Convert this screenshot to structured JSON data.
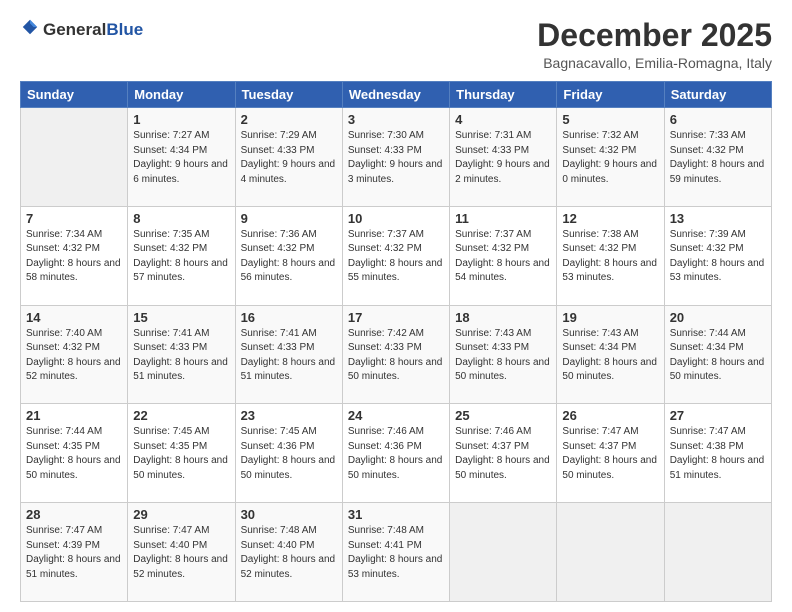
{
  "header": {
    "logo_general": "General",
    "logo_blue": "Blue",
    "month_title": "December 2025",
    "location": "Bagnacavallo, Emilia-Romagna, Italy"
  },
  "weekdays": [
    "Sunday",
    "Monday",
    "Tuesday",
    "Wednesday",
    "Thursday",
    "Friday",
    "Saturday"
  ],
  "weeks": [
    [
      {
        "day": "",
        "sunrise": "",
        "sunset": "",
        "daylight": ""
      },
      {
        "day": "1",
        "sunrise": "Sunrise: 7:27 AM",
        "sunset": "Sunset: 4:34 PM",
        "daylight": "Daylight: 9 hours and 6 minutes."
      },
      {
        "day": "2",
        "sunrise": "Sunrise: 7:29 AM",
        "sunset": "Sunset: 4:33 PM",
        "daylight": "Daylight: 9 hours and 4 minutes."
      },
      {
        "day": "3",
        "sunrise": "Sunrise: 7:30 AM",
        "sunset": "Sunset: 4:33 PM",
        "daylight": "Daylight: 9 hours and 3 minutes."
      },
      {
        "day": "4",
        "sunrise": "Sunrise: 7:31 AM",
        "sunset": "Sunset: 4:33 PM",
        "daylight": "Daylight: 9 hours and 2 minutes."
      },
      {
        "day": "5",
        "sunrise": "Sunrise: 7:32 AM",
        "sunset": "Sunset: 4:32 PM",
        "daylight": "Daylight: 9 hours and 0 minutes."
      },
      {
        "day": "6",
        "sunrise": "Sunrise: 7:33 AM",
        "sunset": "Sunset: 4:32 PM",
        "daylight": "Daylight: 8 hours and 59 minutes."
      }
    ],
    [
      {
        "day": "7",
        "sunrise": "Sunrise: 7:34 AM",
        "sunset": "Sunset: 4:32 PM",
        "daylight": "Daylight: 8 hours and 58 minutes."
      },
      {
        "day": "8",
        "sunrise": "Sunrise: 7:35 AM",
        "sunset": "Sunset: 4:32 PM",
        "daylight": "Daylight: 8 hours and 57 minutes."
      },
      {
        "day": "9",
        "sunrise": "Sunrise: 7:36 AM",
        "sunset": "Sunset: 4:32 PM",
        "daylight": "Daylight: 8 hours and 56 minutes."
      },
      {
        "day": "10",
        "sunrise": "Sunrise: 7:37 AM",
        "sunset": "Sunset: 4:32 PM",
        "daylight": "Daylight: 8 hours and 55 minutes."
      },
      {
        "day": "11",
        "sunrise": "Sunrise: 7:37 AM",
        "sunset": "Sunset: 4:32 PM",
        "daylight": "Daylight: 8 hours and 54 minutes."
      },
      {
        "day": "12",
        "sunrise": "Sunrise: 7:38 AM",
        "sunset": "Sunset: 4:32 PM",
        "daylight": "Daylight: 8 hours and 53 minutes."
      },
      {
        "day": "13",
        "sunrise": "Sunrise: 7:39 AM",
        "sunset": "Sunset: 4:32 PM",
        "daylight": "Daylight: 8 hours and 53 minutes."
      }
    ],
    [
      {
        "day": "14",
        "sunrise": "Sunrise: 7:40 AM",
        "sunset": "Sunset: 4:32 PM",
        "daylight": "Daylight: 8 hours and 52 minutes."
      },
      {
        "day": "15",
        "sunrise": "Sunrise: 7:41 AM",
        "sunset": "Sunset: 4:33 PM",
        "daylight": "Daylight: 8 hours and 51 minutes."
      },
      {
        "day": "16",
        "sunrise": "Sunrise: 7:41 AM",
        "sunset": "Sunset: 4:33 PM",
        "daylight": "Daylight: 8 hours and 51 minutes."
      },
      {
        "day": "17",
        "sunrise": "Sunrise: 7:42 AM",
        "sunset": "Sunset: 4:33 PM",
        "daylight": "Daylight: 8 hours and 50 minutes."
      },
      {
        "day": "18",
        "sunrise": "Sunrise: 7:43 AM",
        "sunset": "Sunset: 4:33 PM",
        "daylight": "Daylight: 8 hours and 50 minutes."
      },
      {
        "day": "19",
        "sunrise": "Sunrise: 7:43 AM",
        "sunset": "Sunset: 4:34 PM",
        "daylight": "Daylight: 8 hours and 50 minutes."
      },
      {
        "day": "20",
        "sunrise": "Sunrise: 7:44 AM",
        "sunset": "Sunset: 4:34 PM",
        "daylight": "Daylight: 8 hours and 50 minutes."
      }
    ],
    [
      {
        "day": "21",
        "sunrise": "Sunrise: 7:44 AM",
        "sunset": "Sunset: 4:35 PM",
        "daylight": "Daylight: 8 hours and 50 minutes."
      },
      {
        "day": "22",
        "sunrise": "Sunrise: 7:45 AM",
        "sunset": "Sunset: 4:35 PM",
        "daylight": "Daylight: 8 hours and 50 minutes."
      },
      {
        "day": "23",
        "sunrise": "Sunrise: 7:45 AM",
        "sunset": "Sunset: 4:36 PM",
        "daylight": "Daylight: 8 hours and 50 minutes."
      },
      {
        "day": "24",
        "sunrise": "Sunrise: 7:46 AM",
        "sunset": "Sunset: 4:36 PM",
        "daylight": "Daylight: 8 hours and 50 minutes."
      },
      {
        "day": "25",
        "sunrise": "Sunrise: 7:46 AM",
        "sunset": "Sunset: 4:37 PM",
        "daylight": "Daylight: 8 hours and 50 minutes."
      },
      {
        "day": "26",
        "sunrise": "Sunrise: 7:47 AM",
        "sunset": "Sunset: 4:37 PM",
        "daylight": "Daylight: 8 hours and 50 minutes."
      },
      {
        "day": "27",
        "sunrise": "Sunrise: 7:47 AM",
        "sunset": "Sunset: 4:38 PM",
        "daylight": "Daylight: 8 hours and 51 minutes."
      }
    ],
    [
      {
        "day": "28",
        "sunrise": "Sunrise: 7:47 AM",
        "sunset": "Sunset: 4:39 PM",
        "daylight": "Daylight: 8 hours and 51 minutes."
      },
      {
        "day": "29",
        "sunrise": "Sunrise: 7:47 AM",
        "sunset": "Sunset: 4:40 PM",
        "daylight": "Daylight: 8 hours and 52 minutes."
      },
      {
        "day": "30",
        "sunrise": "Sunrise: 7:48 AM",
        "sunset": "Sunset: 4:40 PM",
        "daylight": "Daylight: 8 hours and 52 minutes."
      },
      {
        "day": "31",
        "sunrise": "Sunrise: 7:48 AM",
        "sunset": "Sunset: 4:41 PM",
        "daylight": "Daylight: 8 hours and 53 minutes."
      },
      {
        "day": "",
        "sunrise": "",
        "sunset": "",
        "daylight": ""
      },
      {
        "day": "",
        "sunrise": "",
        "sunset": "",
        "daylight": ""
      },
      {
        "day": "",
        "sunrise": "",
        "sunset": "",
        "daylight": ""
      }
    ]
  ]
}
